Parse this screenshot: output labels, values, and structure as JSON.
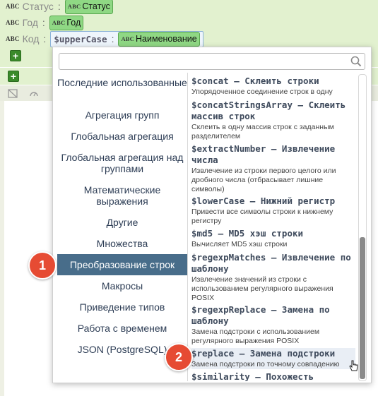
{
  "fields": [
    {
      "abc": "ABC",
      "name": "Статус",
      "value_abc": "ABC",
      "value": "Статус"
    },
    {
      "abc": "ABC",
      "name": "Год",
      "value_abc": "ABC",
      "value": "Год"
    },
    {
      "abc": "ABC",
      "name": "Код",
      "func": "$upperCase",
      "value_abc": "ABC",
      "value": "Наименование"
    }
  ],
  "separator": ":",
  "popup": {
    "search": {
      "placeholder": "",
      "value": ""
    },
    "categories": [
      {
        "label": "Последние использованные"
      },
      {
        "label": "Агрегация групп"
      },
      {
        "label": "Глобальная агрегация"
      },
      {
        "label": "Глобальная агрегация над группами"
      },
      {
        "label": "Математические выражения"
      },
      {
        "label": "Другие"
      },
      {
        "label": "Множества"
      },
      {
        "label": "Преобразование строк",
        "active": true
      },
      {
        "label": "Макросы"
      },
      {
        "label": "Приведение типов"
      },
      {
        "label": "Работа с временем"
      },
      {
        "label": "JSON (PostgreSQL)"
      }
    ],
    "functions": [
      {
        "title": "$concat – Склеить строки",
        "desc": "Упорядоченное соединение строк в одну"
      },
      {
        "title": "$concatStringsArray – Склеить массив строк",
        "desc": "Склеить в одну массив строк с заданным разделителем"
      },
      {
        "title": "$extractNumber – Извлечение числа",
        "desc": "Извлечение из строки первого целого или дробного числа (отбрасывает лишние символы)"
      },
      {
        "title": "$lowerCase – Нижний регистр",
        "desc": "Привести все символы строки к нижнему регистру"
      },
      {
        "title": "$md5 – MD5 хэш строки",
        "desc": "Вычисляет MD5 хэш строки"
      },
      {
        "title": "$regexpMatches – Извлечение по шаблону",
        "desc": "Извлечение значений из строки с использованием регулярного выражения POSIX"
      },
      {
        "title": "$regexpReplace – Замена по шаблону",
        "desc": "Замена подстроки с использованием регулярного выражения POSIX"
      },
      {
        "title": "$replace – Замена подстроки",
        "desc": "Замена подстроки по точному совпадению",
        "highlighted": true
      },
      {
        "title": "$similarity – Похожесть",
        "desc": ""
      }
    ]
  },
  "badges": [
    "1",
    "2"
  ],
  "icons": {
    "search": "magnifier-icon",
    "add": "plus-icon",
    "cursor": "hand-pointer-icon"
  },
  "colors": {
    "accent": "#486d8a",
    "badge": "#e64b33",
    "chip": "#8fd884",
    "add": "#3a8a2a"
  }
}
